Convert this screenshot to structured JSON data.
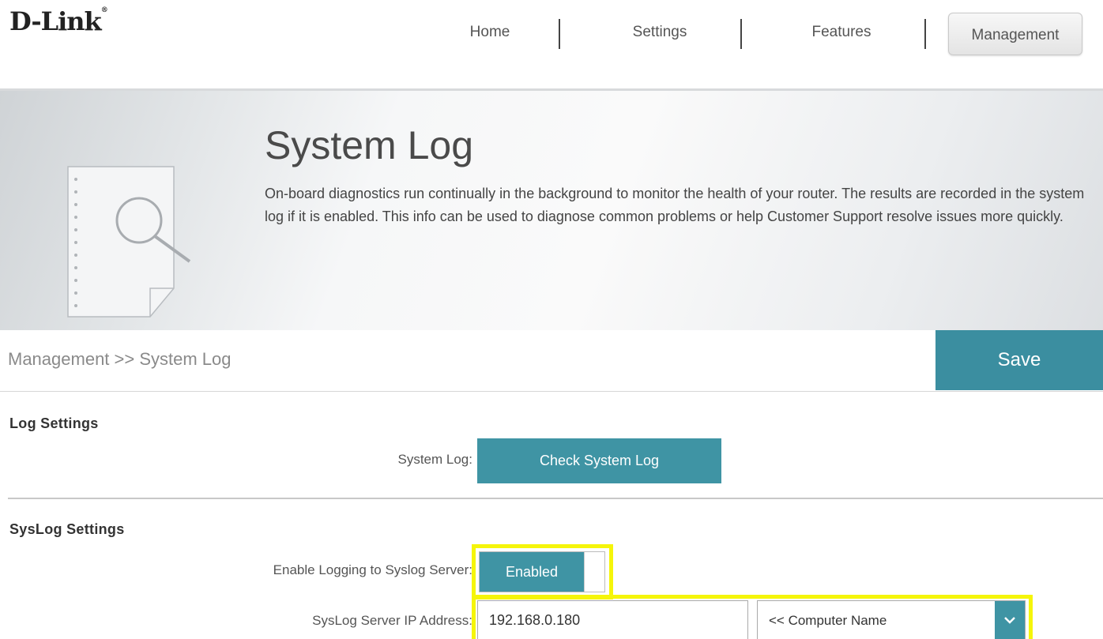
{
  "header": {
    "logo": "D-Link",
    "nav": [
      {
        "label": "Home"
      },
      {
        "label": "Settings"
      },
      {
        "label": "Features"
      },
      {
        "label": "Management"
      }
    ],
    "active_nav": "Management"
  },
  "banner": {
    "title": "System Log",
    "description": "On-board diagnostics run continually in the background to monitor the health of your router. The results are recorded in the system log if it is enabled. This info can be used to diagnose common problems or help Customer Support resolve issues more quickly.",
    "icon": "document-search-icon"
  },
  "breadcrumb": "Management >> System Log",
  "save_label": "Save",
  "log_settings": {
    "title": "Log Settings",
    "system_log_label": "System Log:",
    "check_button": "Check System Log"
  },
  "syslog_settings": {
    "title": "SysLog Settings",
    "enable_label": "Enable Logging to Syslog Server:",
    "enable_state": "Enabled",
    "ip_label": "SysLog Server IP Address:",
    "ip_value": "192.168.0.180",
    "computer_select": "<< Computer Name"
  },
  "colors": {
    "accent": "#3f94a4",
    "highlight": "#f5f50a"
  }
}
